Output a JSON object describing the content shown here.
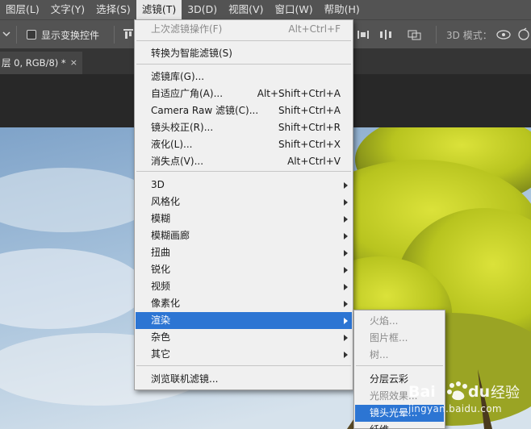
{
  "menubar": {
    "items": [
      "图层(L)",
      "文字(Y)",
      "选择(S)",
      "滤镜(T)",
      "3D(D)",
      "视图(V)",
      "窗口(W)",
      "帮助(H)"
    ],
    "active_index": 3
  },
  "optionsbar": {
    "show_transform_label": "显示变换控件",
    "mode_3d_label": "3D 模式："
  },
  "document": {
    "tab_label": "层 0, RGB/8) *",
    "close_glyph": "×"
  },
  "filter_menu": {
    "items": [
      {
        "label": "上次滤镜操作(F)",
        "shortcut": "Alt+Ctrl+F",
        "disabled": true
      },
      {
        "label": "转换为智能滤镜(S)"
      },
      {
        "label": "滤镜库(G)..."
      },
      {
        "label": "自适应广角(A)...",
        "shortcut": "Alt+Shift+Ctrl+A"
      },
      {
        "label": "Camera Raw 滤镜(C)...",
        "shortcut": "Shift+Ctrl+A"
      },
      {
        "label": "镜头校正(R)...",
        "shortcut": "Shift+Ctrl+R"
      },
      {
        "label": "液化(L)...",
        "shortcut": "Shift+Ctrl+X"
      },
      {
        "label": "消失点(V)...",
        "shortcut": "Alt+Ctrl+V"
      },
      {
        "label": "3D",
        "submenu": true
      },
      {
        "label": "风格化",
        "submenu": true
      },
      {
        "label": "模糊",
        "submenu": true
      },
      {
        "label": "模糊画廊",
        "submenu": true
      },
      {
        "label": "扭曲",
        "submenu": true
      },
      {
        "label": "锐化",
        "submenu": true
      },
      {
        "label": "视频",
        "submenu": true
      },
      {
        "label": "像素化",
        "submenu": true
      },
      {
        "label": "渲染",
        "submenu": true,
        "highlighted": true
      },
      {
        "label": "杂色",
        "submenu": true
      },
      {
        "label": "其它",
        "submenu": true
      },
      {
        "label": "浏览联机滤镜..."
      }
    ]
  },
  "render_submenu": {
    "items": [
      {
        "label": "火焰...",
        "disabled": true
      },
      {
        "label": "图片框...",
        "disabled": true
      },
      {
        "label": "树...",
        "disabled": true
      },
      {
        "label": "分层云彩"
      },
      {
        "label": "光照效果...",
        "disabled": true
      },
      {
        "label": "镜头光晕...",
        "highlighted": true
      },
      {
        "label": "纤维..."
      }
    ]
  },
  "watermark": {
    "brand": "Baidu经验",
    "url": "jingyan.baidu.com"
  },
  "colors": {
    "menubar_bg": "#535353",
    "menu_bg": "#f0f0f0",
    "highlight": "#2c75d3",
    "workspace_bg": "#282828"
  }
}
